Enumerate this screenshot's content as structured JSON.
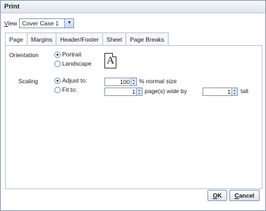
{
  "window": {
    "title": "Print"
  },
  "view": {
    "label_first": "V",
    "label_rest": "iew",
    "selected": "Cover Case 1"
  },
  "tabs": [
    {
      "label": "Page",
      "active": true
    },
    {
      "label": "Margins",
      "active": false
    },
    {
      "label": "Header/Footer",
      "active": false
    },
    {
      "label": "Sheet",
      "active": false
    },
    {
      "label": "Page Breaks",
      "active": false
    }
  ],
  "orientation": {
    "label": "Orientation",
    "options": [
      "Portrait",
      "Landscape"
    ],
    "selected": "Portrait",
    "icon": "portrait-page-icon",
    "icon_letter": "A"
  },
  "scaling": {
    "label": "Scaling",
    "adjust_label": "Adjust to:",
    "adjust_value": "100",
    "adjust_suffix": "% normal size",
    "fit_label": "Fit to:",
    "fit_wide_value": "1",
    "fit_wide_suffix": "page(s) wide by",
    "fit_tall_value": "1",
    "fit_tall_suffix": "tall",
    "selected": "Adjust to"
  },
  "buttons": {
    "ok_first": "O",
    "ok_rest": "K",
    "cancel_first": "C",
    "cancel_rest": "ancel"
  }
}
